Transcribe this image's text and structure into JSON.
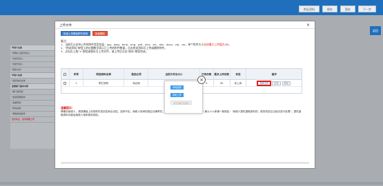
{
  "background": {
    "toolbar": [
      "附证资料",
      "保存",
      "暂存",
      "下一步"
    ],
    "side_button": "返回",
    "form_rows": [
      {
        "text": "申请人信息",
        "type": "head"
      },
      {
        "text": "*所属人/法定代表人",
        "type": ""
      },
      {
        "text": "*负责代表人",
        "type": ""
      },
      {
        "text": "*法定代表人",
        "type": ""
      },
      {
        "text": "*联系方式",
        "type": ""
      },
      {
        "text": "申请人信息",
        "type": "head"
      },
      {
        "text": "*监管信息主体",
        "type": ""
      },
      {
        "text": "监管部门基本内容",
        "type": "head"
      },
      {
        "text": "*部门或代码",
        "type": ""
      },
      {
        "text": "*监管所属机构",
        "type": ""
      },
      {
        "text": "*监督机构",
        "type": ""
      },
      {
        "text": "*所在地址",
        "type": ""
      },
      {
        "text": "*保险机构名称",
        "type": ""
      },
      {
        "text": "监管信息：如有需要上传",
        "type": "warn"
      }
    ]
  },
  "modal": {
    "title": "上传文件",
    "actions": {
      "batch_upload": "批量上传模板附件说明",
      "batch_delete": "批量删除"
    },
    "notes": {
      "heading": "备注：",
      "line1_a": "1、当前可以支持上传的附件类型包括：jpg、jpeg、bmp、png、pdf、xlsx、xls、doc、docx、zip、rar，单个附件大小",
      "line1_red": "支持最大上传值为4M。",
      "line2": "2、\"附送资料\"按钮上的红圈数字表示已上传的附件数量，点击附送资料可上传或删除附件。",
      "line3": "3、点击右上角\"×\"按钮或保存可上传文件，请上传后点击\"保存\"按钮完成。"
    },
    "table": {
      "headers": [
        "",
        "序号",
        "附送资料名称",
        "是否必须",
        "当前文件及大小",
        "已传份数",
        "最多上传份数",
        "状态",
        "操作"
      ],
      "rows": [
        {
          "no": "1",
          "name": "附它资料",
          "required": "非必填",
          "file": "",
          "uploaded": "0",
          "max": "50",
          "status": "未上传",
          "op_upload": "选择文件",
          "op_view": "查看",
          "op_delete": "删除"
        }
      ],
      "footer": "温馨提示"
    },
    "warning": {
      "title": "温馨提示：",
      "text": "尊敬的纳税人，请您确保上传的附件真实性和合法性。如有不实，纳税人将承担相应法律责任，请按《企业所得税管理法实施细则》第九十六条第一款规定：\"纳税人提供虚假资料的，税务机关应当依法进行处理\"；提供虚假资料可能给纳税人带来税务风险。"
    }
  },
  "popup": {
    "close": "×",
    "buttons": [
      "本地选择",
      "本机上传",
      "浏览选取/扫描件"
    ]
  }
}
